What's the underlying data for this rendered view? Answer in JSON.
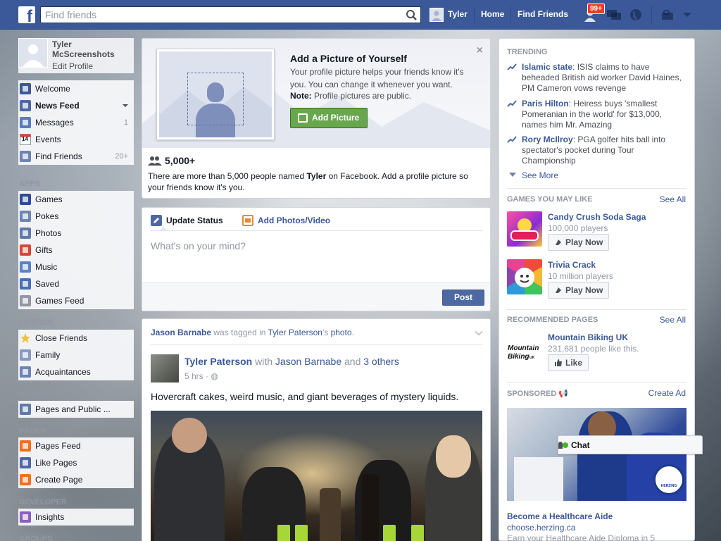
{
  "topbar": {
    "logo": "f",
    "search_placeholder": "Find friends",
    "user_name": "Tyler",
    "home": "Home",
    "find_friends": "Find Friends",
    "friend_requests_badge": "99+"
  },
  "left": {
    "profile_name": "Tyler McScreenshots",
    "edit_profile": "Edit Profile",
    "main": [
      {
        "label": "Welcome",
        "icon": "facebook-icon",
        "color": "#3b5998"
      },
      {
        "label": "News Feed",
        "icon": "news-feed-icon",
        "color": "#4e69a2",
        "bold": true
      },
      {
        "label": "Messages",
        "icon": "messages-icon",
        "color": "#5b7bbf",
        "count": "1"
      },
      {
        "label": "Events",
        "icon": "calendar-icon",
        "color": "#e9ebee",
        "count": "",
        "badge": "14"
      },
      {
        "label": "Find Friends",
        "icon": "find-friends-icon",
        "color": "#6d84b4",
        "count": "20+"
      }
    ],
    "apps_head": "APPS",
    "apps": [
      {
        "label": "Games",
        "icon": "games-icon",
        "color": "#2d4d92"
      },
      {
        "label": "Pokes",
        "icon": "pokes-icon",
        "color": "#6d84b4"
      },
      {
        "label": "Photos",
        "icon": "photos-icon",
        "color": "#5f7aa9"
      },
      {
        "label": "Gifts",
        "icon": "gifts-icon",
        "color": "#d8453a"
      },
      {
        "label": "Music",
        "icon": "music-icon",
        "color": "#5a83c7"
      },
      {
        "label": "Saved",
        "icon": "saved-icon",
        "color": "#4a6fb5"
      },
      {
        "label": "Games Feed",
        "icon": "games-feed-icon",
        "color": "#9197a3"
      }
    ],
    "friends_head": "FRIENDS",
    "friends": [
      {
        "label": "Close Friends",
        "icon": "star-icon",
        "color": "#f0c238"
      },
      {
        "label": "Family",
        "icon": "family-icon",
        "color": "#8898c5"
      },
      {
        "label": "Acquaintances",
        "icon": "acquaintances-icon",
        "color": "#6d84b4"
      }
    ],
    "interests_head": "INTERESTS",
    "interests": [
      {
        "label": "Pages and Public ...",
        "icon": "rss-icon",
        "color": "#5f7aa9"
      }
    ],
    "pages_head": "PAGES",
    "pages": [
      {
        "label": "Pages Feed",
        "icon": "pages-feed-icon",
        "color": "#f36f21"
      },
      {
        "label": "Like Pages",
        "icon": "like-icon",
        "color": "#4e69a2"
      },
      {
        "label": "Create Page",
        "icon": "create-page-icon",
        "color": "#f36f21"
      }
    ],
    "developer_head": "DEVELOPER",
    "developer": [
      {
        "label": "Insights",
        "icon": "insights-icon",
        "color": "#8b5fbf"
      }
    ],
    "groups_head": "GROUPS"
  },
  "add_picture": {
    "title": "Add a Picture of Yourself",
    "text": "Your profile picture helps your friends know it's you. You can change it whenever you want.",
    "note_label": "Note:",
    "note_text": " Profile pictures are public.",
    "button": "Add Picture",
    "count": "5,000+",
    "desc_pre": "There are more than 5,000 people named ",
    "desc_name": "Tyler",
    "desc_post": " on Facebook. Add a profile picture so your friends know it's you."
  },
  "status": {
    "tab_update": "Update Status",
    "tab_photos": "Add Photos/Video",
    "placeholder": "What's on your mind?",
    "post_button": "Post"
  },
  "post": {
    "header_actor": "Jason Barnabe",
    "header_mid": " was tagged in ",
    "header_owner": "Tyler Paterson",
    "header_possessive": "'s ",
    "header_object": "photo",
    "header_end": ".",
    "author": "Tyler Paterson",
    "with": " with ",
    "tagged": "Jason Barnabe",
    "and": " and ",
    "others": "3 others",
    "time": "5 hrs · ",
    "text": "Hovercraft cakes, weird music, and giant beverages of mystery liquids."
  },
  "right": {
    "trending_head": "TRENDING",
    "trending": [
      {
        "topic": "Islamic state",
        "text": ": ISIS claims to have beheaded British aid worker David Haines, PM Cameron vows revenge"
      },
      {
        "topic": "Paris Hilton",
        "text": ": Heiress buys 'smallest Pomeranian in the world' for $13,000, names him Mr. Amazing"
      },
      {
        "topic": "Rory McIlroy",
        "text": ": PGA golfer hits ball into spectator's pocket during Tour Championship"
      }
    ],
    "see_more": "See More",
    "games_head": "GAMES YOU MAY LIKE",
    "see_all": "See All",
    "games": [
      {
        "name": "Candy Crush Soda Saga",
        "players": "100,000 players",
        "button": "Play Now"
      },
      {
        "name": "Trivia Crack",
        "players": "10 million players",
        "button": "Play Now"
      }
    ],
    "pages_head": "RECOMMENDED PAGES",
    "page_name": "Mountain Biking UK",
    "page_likes": "231,681 people like this.",
    "page_button": "Like",
    "page_logo_text": "Mountain Biking UK",
    "sponsored_head": "SPONSORED",
    "create_ad": "Create Ad",
    "ad_title": "Become a Healthcare Aide",
    "ad_url": "choose.herzing.ca",
    "ad_desc": "Earn your Healthcare Aide Diploma in 5",
    "ad_logo_text": "HERZING"
  },
  "chat": {
    "label": "Chat"
  }
}
